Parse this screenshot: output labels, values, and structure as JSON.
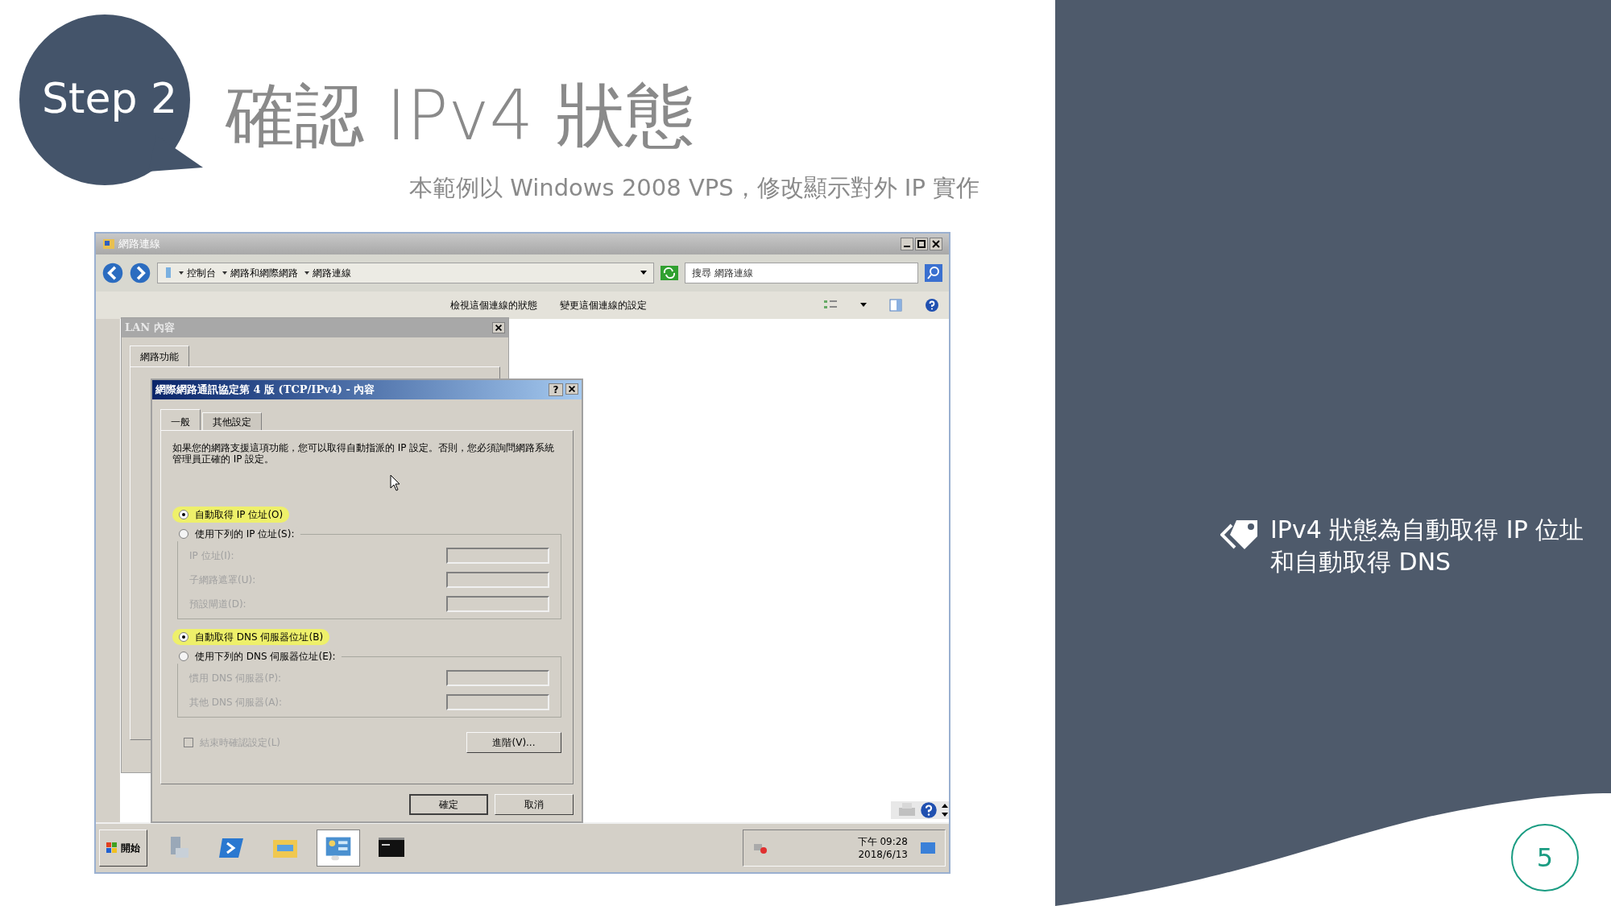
{
  "step_badge": "Step 2",
  "title": "確認 IPv4 狀態",
  "subtitle": "本範例以 Windows 2008 VPS，修改顯示對外 IP 實作",
  "screenshot": {
    "explorer": {
      "title": "網路連線",
      "breadcrumb": [
        "控制台",
        "網路和網際網路",
        "網路連線"
      ],
      "search": {
        "placeholder": "搜尋 網路連線"
      },
      "commands": [
        "檢視這個連線的狀態",
        "變更這個連線的設定"
      ]
    },
    "lan_dialog": {
      "title": "LAN 內容",
      "tabs": [
        {
          "label": "網路功能",
          "selected": true
        }
      ]
    },
    "tcp_dialog": {
      "title": "網際網路通訊協定第 4 版 (TCP/IPv4) - 內容",
      "help": "?",
      "tabs": [
        {
          "label": "一般",
          "selected": true
        },
        {
          "label": "其他設定",
          "selected": false
        }
      ],
      "description": "如果您的網路支援這項功能，您可以取得自動指派的 IP 設定。否則，您必須詢問網路系統管理員正確的 IP 設定。",
      "ip_options": [
        {
          "label": "自動取得 IP 位址(O)",
          "selected": true,
          "highlighted": true
        },
        {
          "label": "使用下列的 IP 位址(S):",
          "selected": false,
          "highlighted": false
        }
      ],
      "ip_fields": [
        {
          "label": "IP 位址(I):",
          "disabled": true
        },
        {
          "label": "子網路遮罩(U):",
          "disabled": true
        },
        {
          "label": "預設閘道(D):",
          "disabled": true
        }
      ],
      "dns_options": [
        {
          "label": "自動取得 DNS 伺服器位址(B)",
          "selected": true,
          "highlighted": true
        },
        {
          "label": "使用下列的 DNS 伺服器位址(E):",
          "selected": false,
          "highlighted": false
        }
      ],
      "dns_fields": [
        {
          "label": "慣用 DNS 伺服器(P):",
          "disabled": true
        },
        {
          "label": "其他 DNS 伺服器(A):",
          "disabled": true
        }
      ],
      "validate": {
        "label": "結束時確認設定(L)",
        "checked": false,
        "disabled": true
      },
      "advanced": "進階(V)...",
      "buttons": [
        "確定",
        "取消"
      ]
    },
    "taskbar": {
      "start": "開始",
      "clock_time": "下午 09:28",
      "clock_date": "2018/6/13"
    }
  },
  "note": "IPv4 狀態為自動取得 IP 位址和自動取得 DNS",
  "page_number": "5"
}
